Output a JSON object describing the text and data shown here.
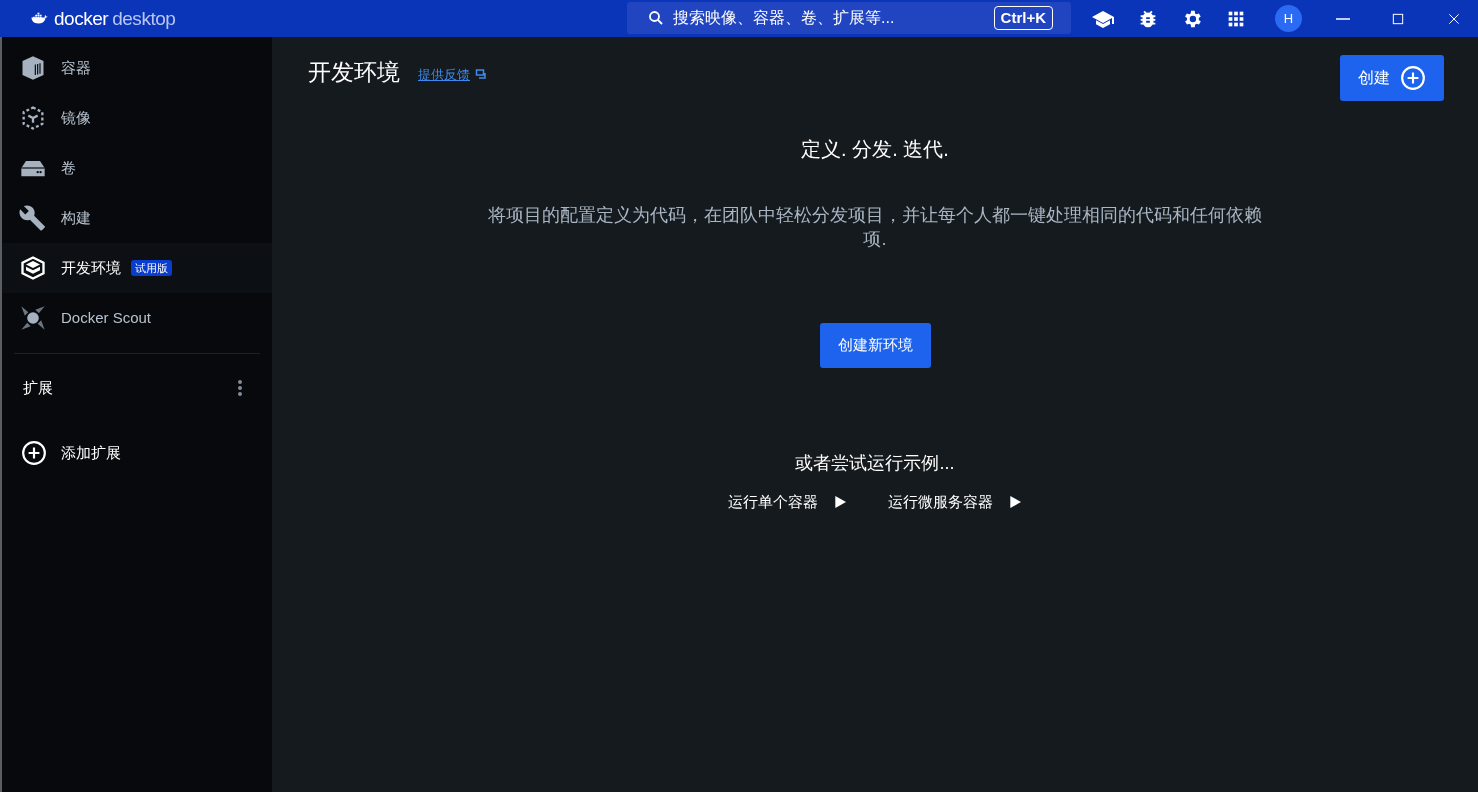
{
  "titlebar": {
    "brand": "docker",
    "product": "desktop",
    "search": {
      "placeholder": "搜索映像、容器、卷、扩展等...",
      "shortcut": "Ctrl+K"
    },
    "avatar": "H"
  },
  "sidebar": {
    "items": [
      {
        "label": "容器",
        "selected": false
      },
      {
        "label": "镜像",
        "selected": false
      },
      {
        "label": "卷",
        "selected": false
      },
      {
        "label": "构建",
        "selected": false
      },
      {
        "label": "开发环境",
        "selected": true,
        "badge": "试用版"
      },
      {
        "label": "Docker Scout",
        "selected": false
      }
    ],
    "extensions_heading": "扩展",
    "add_extension": "添加扩展"
  },
  "page": {
    "title": "开发环境",
    "feedback_link": "提供反馈",
    "create_button": "创建",
    "heading": "定义. 分发. 迭代.",
    "description": "将项目的配置定义为代码，在团队中轻松分发项目，并让每个人都一键处理相同的代码和任何依赖项.",
    "primary_button": "创建新环境",
    "samples_heading": "或者尝试运行示例...",
    "samples": [
      "运行单个容器",
      "运行微服务容器"
    ]
  }
}
